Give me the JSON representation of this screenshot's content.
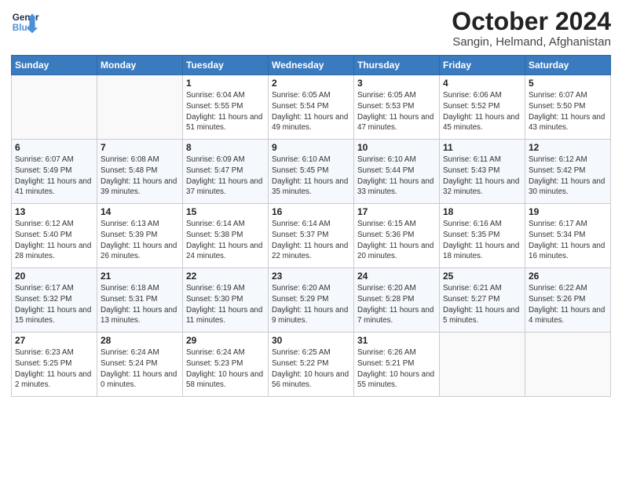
{
  "header": {
    "logo_line1": "General",
    "logo_line2": "Blue",
    "month": "October 2024",
    "location": "Sangin, Helmand, Afghanistan"
  },
  "days_of_week": [
    "Sunday",
    "Monday",
    "Tuesday",
    "Wednesday",
    "Thursday",
    "Friday",
    "Saturday"
  ],
  "weeks": [
    [
      {
        "day": "",
        "info": ""
      },
      {
        "day": "",
        "info": ""
      },
      {
        "day": "1",
        "info": "Sunrise: 6:04 AM\nSunset: 5:55 PM\nDaylight: 11 hours and 51 minutes."
      },
      {
        "day": "2",
        "info": "Sunrise: 6:05 AM\nSunset: 5:54 PM\nDaylight: 11 hours and 49 minutes."
      },
      {
        "day": "3",
        "info": "Sunrise: 6:05 AM\nSunset: 5:53 PM\nDaylight: 11 hours and 47 minutes."
      },
      {
        "day": "4",
        "info": "Sunrise: 6:06 AM\nSunset: 5:52 PM\nDaylight: 11 hours and 45 minutes."
      },
      {
        "day": "5",
        "info": "Sunrise: 6:07 AM\nSunset: 5:50 PM\nDaylight: 11 hours and 43 minutes."
      }
    ],
    [
      {
        "day": "6",
        "info": "Sunrise: 6:07 AM\nSunset: 5:49 PM\nDaylight: 11 hours and 41 minutes."
      },
      {
        "day": "7",
        "info": "Sunrise: 6:08 AM\nSunset: 5:48 PM\nDaylight: 11 hours and 39 minutes."
      },
      {
        "day": "8",
        "info": "Sunrise: 6:09 AM\nSunset: 5:47 PM\nDaylight: 11 hours and 37 minutes."
      },
      {
        "day": "9",
        "info": "Sunrise: 6:10 AM\nSunset: 5:45 PM\nDaylight: 11 hours and 35 minutes."
      },
      {
        "day": "10",
        "info": "Sunrise: 6:10 AM\nSunset: 5:44 PM\nDaylight: 11 hours and 33 minutes."
      },
      {
        "day": "11",
        "info": "Sunrise: 6:11 AM\nSunset: 5:43 PM\nDaylight: 11 hours and 32 minutes."
      },
      {
        "day": "12",
        "info": "Sunrise: 6:12 AM\nSunset: 5:42 PM\nDaylight: 11 hours and 30 minutes."
      }
    ],
    [
      {
        "day": "13",
        "info": "Sunrise: 6:12 AM\nSunset: 5:40 PM\nDaylight: 11 hours and 28 minutes."
      },
      {
        "day": "14",
        "info": "Sunrise: 6:13 AM\nSunset: 5:39 PM\nDaylight: 11 hours and 26 minutes."
      },
      {
        "day": "15",
        "info": "Sunrise: 6:14 AM\nSunset: 5:38 PM\nDaylight: 11 hours and 24 minutes."
      },
      {
        "day": "16",
        "info": "Sunrise: 6:14 AM\nSunset: 5:37 PM\nDaylight: 11 hours and 22 minutes."
      },
      {
        "day": "17",
        "info": "Sunrise: 6:15 AM\nSunset: 5:36 PM\nDaylight: 11 hours and 20 minutes."
      },
      {
        "day": "18",
        "info": "Sunrise: 6:16 AM\nSunset: 5:35 PM\nDaylight: 11 hours and 18 minutes."
      },
      {
        "day": "19",
        "info": "Sunrise: 6:17 AM\nSunset: 5:34 PM\nDaylight: 11 hours and 16 minutes."
      }
    ],
    [
      {
        "day": "20",
        "info": "Sunrise: 6:17 AM\nSunset: 5:32 PM\nDaylight: 11 hours and 15 minutes."
      },
      {
        "day": "21",
        "info": "Sunrise: 6:18 AM\nSunset: 5:31 PM\nDaylight: 11 hours and 13 minutes."
      },
      {
        "day": "22",
        "info": "Sunrise: 6:19 AM\nSunset: 5:30 PM\nDaylight: 11 hours and 11 minutes."
      },
      {
        "day": "23",
        "info": "Sunrise: 6:20 AM\nSunset: 5:29 PM\nDaylight: 11 hours and 9 minutes."
      },
      {
        "day": "24",
        "info": "Sunrise: 6:20 AM\nSunset: 5:28 PM\nDaylight: 11 hours and 7 minutes."
      },
      {
        "day": "25",
        "info": "Sunrise: 6:21 AM\nSunset: 5:27 PM\nDaylight: 11 hours and 5 minutes."
      },
      {
        "day": "26",
        "info": "Sunrise: 6:22 AM\nSunset: 5:26 PM\nDaylight: 11 hours and 4 minutes."
      }
    ],
    [
      {
        "day": "27",
        "info": "Sunrise: 6:23 AM\nSunset: 5:25 PM\nDaylight: 11 hours and 2 minutes."
      },
      {
        "day": "28",
        "info": "Sunrise: 6:24 AM\nSunset: 5:24 PM\nDaylight: 11 hours and 0 minutes."
      },
      {
        "day": "29",
        "info": "Sunrise: 6:24 AM\nSunset: 5:23 PM\nDaylight: 10 hours and 58 minutes."
      },
      {
        "day": "30",
        "info": "Sunrise: 6:25 AM\nSunset: 5:22 PM\nDaylight: 10 hours and 56 minutes."
      },
      {
        "day": "31",
        "info": "Sunrise: 6:26 AM\nSunset: 5:21 PM\nDaylight: 10 hours and 55 minutes."
      },
      {
        "day": "",
        "info": ""
      },
      {
        "day": "",
        "info": ""
      }
    ]
  ]
}
